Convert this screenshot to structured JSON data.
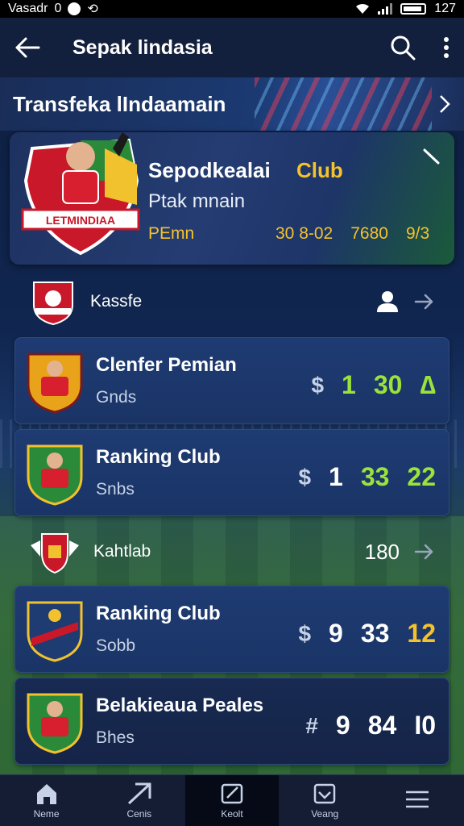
{
  "status_bar": {
    "left_text": "Vasadr",
    "icon_a": "0",
    "time": "127"
  },
  "app_bar": {
    "title": "Sepak lindasia"
  },
  "banner": {
    "title": "Transfeka lIndaamain"
  },
  "hero": {
    "name": "Sepodkealai",
    "club": "Club",
    "subtitle": "Ptak mnain",
    "label": "PEmn",
    "stats": [
      "30 8-02",
      "7680",
      "9/3"
    ],
    "badge_text": "LETMINDIAA"
  },
  "sections": [
    {
      "label": "Kassfe"
    },
    {
      "label": "Kahtlab",
      "value": "180"
    }
  ],
  "cards": [
    {
      "title": "Clenfer Pemian",
      "subtitle": "Gnds",
      "hash": "$",
      "s1": "1",
      "s2": "30",
      "s3": "∆"
    },
    {
      "title": "Ranking Club",
      "subtitle": "Snbs",
      "hash": "$",
      "s1": "1",
      "s2": "33",
      "s3": "22"
    },
    {
      "title": "Ranking Club",
      "subtitle": "Sobb",
      "hash": "$",
      "s1": "9",
      "s2": "33",
      "s3": "12"
    },
    {
      "title": "Belakieaua Peales",
      "subtitle": "Bhes",
      "hash": "#",
      "s1": "9",
      "s2": "84",
      "s3": "I0"
    }
  ],
  "bottom_nav": [
    {
      "label": "Neme"
    },
    {
      "label": "Cenis"
    },
    {
      "label": "Keolt"
    },
    {
      "label": "Veang"
    },
    {
      "label": ""
    }
  ],
  "colors": {
    "accent_yellow": "#f4c22b",
    "accent_green": "#9be23a",
    "card_blue": "#1e3b72",
    "app_bar": "#13203d"
  }
}
